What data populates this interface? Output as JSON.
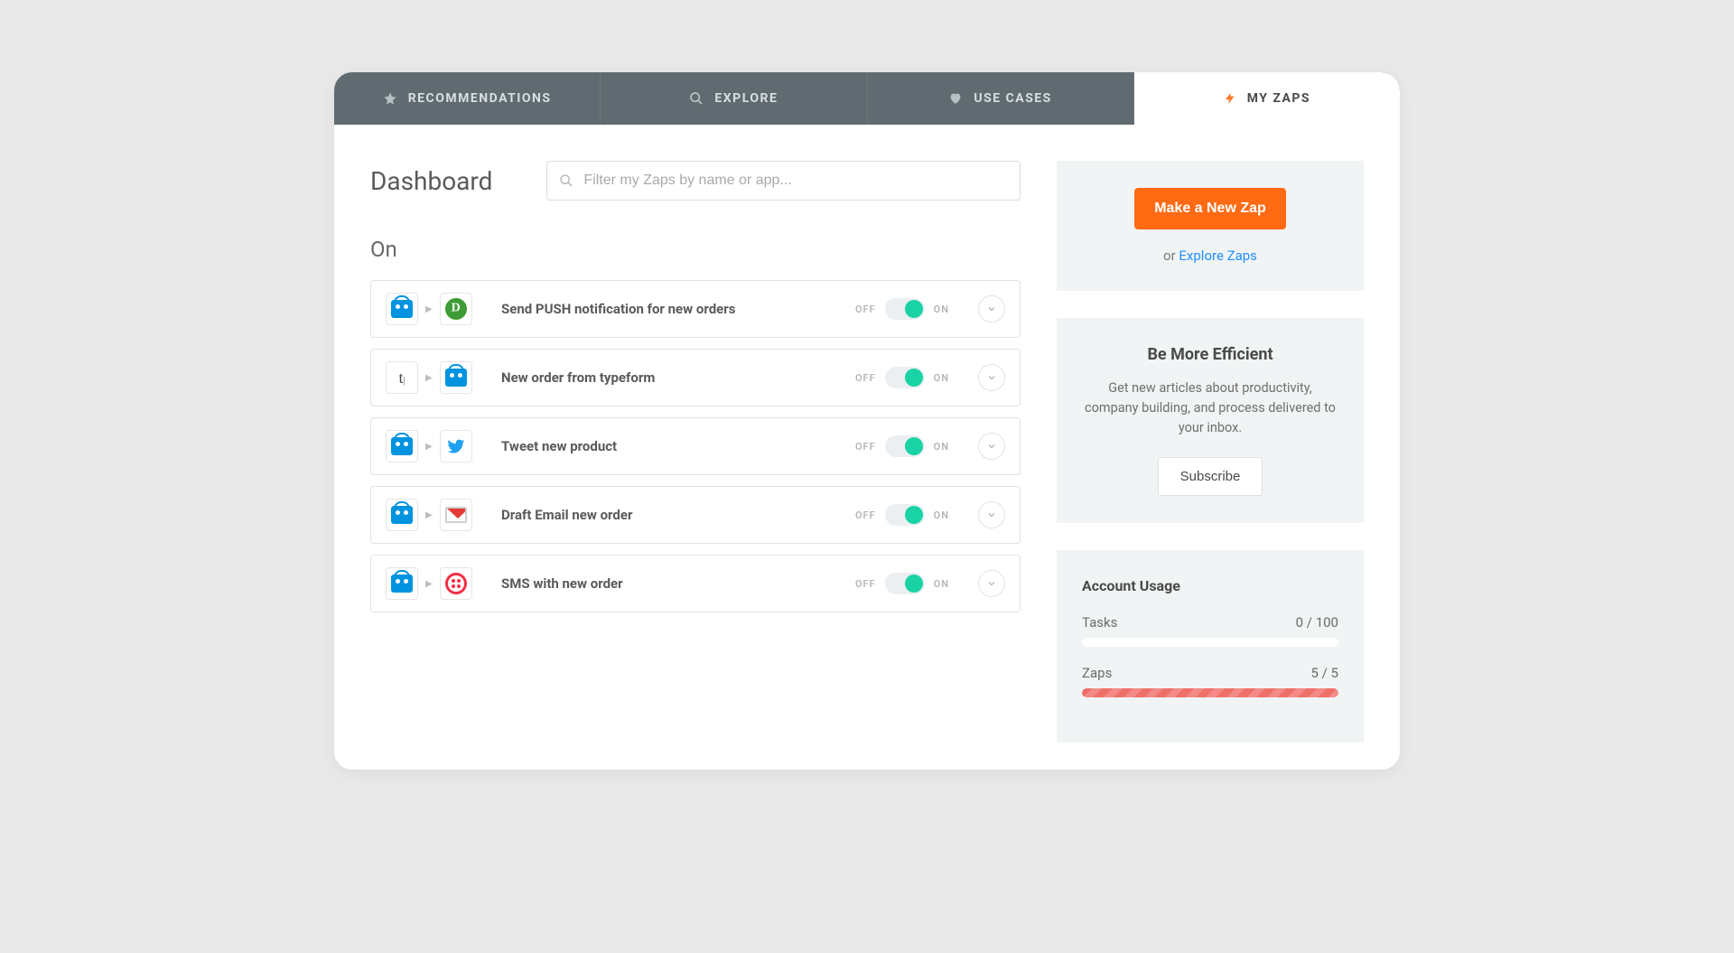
{
  "tabs": [
    {
      "label": "RECOMMENDATIONS",
      "icon": "star-icon"
    },
    {
      "label": "EXPLORE",
      "icon": "search-icon"
    },
    {
      "label": "USE CASES",
      "icon": "heart-icon"
    },
    {
      "label": "MY ZAPS",
      "icon": "bolt-icon",
      "active": true
    }
  ],
  "page_title": "Dashboard",
  "search": {
    "placeholder": "Filter my Zaps by name or app..."
  },
  "section_on": "On",
  "toggle_labels": {
    "off": "OFF",
    "on": "ON"
  },
  "zaps": [
    {
      "title": "Send PUSH notification for new orders",
      "from": "ecwid",
      "to": "pushbullet",
      "state": "on"
    },
    {
      "title": "New order from typeform",
      "from": "typeform",
      "to": "ecwid",
      "state": "on"
    },
    {
      "title": "Tweet new product",
      "from": "ecwid",
      "to": "twitter",
      "state": "on"
    },
    {
      "title": "Draft Email new order",
      "from": "ecwid",
      "to": "gmail",
      "state": "on"
    },
    {
      "title": "SMS with new order",
      "from": "ecwid",
      "to": "twilio",
      "state": "on"
    }
  ],
  "sidebar": {
    "new_zap": "Make a New Zap",
    "or": "or ",
    "explore_link": "Explore Zaps",
    "efficient_title": "Be More Efficient",
    "efficient_text": "Get new articles about productivity, company building, and process delivered to your inbox.",
    "subscribe": "Subscribe",
    "usage_title": "Account Usage",
    "tasks_label": "Tasks",
    "tasks_value": "0 / 100",
    "zaps_label": "Zaps",
    "zaps_value": "5 / 5"
  }
}
